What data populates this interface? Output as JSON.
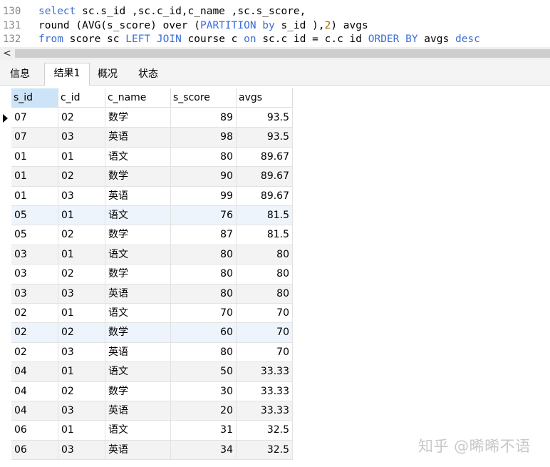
{
  "editor": {
    "lines": [
      {
        "num": "130",
        "parts": [
          {
            "t": "select",
            "c": "kw"
          },
          {
            "t": " sc.s_id ,sc.c_id,c_name ,sc.s_score,",
            "c": ""
          }
        ]
      },
      {
        "num": "131",
        "parts": [
          {
            "t": "round (AVG(s_score) over (",
            "c": ""
          },
          {
            "t": "PARTITION by",
            "c": "kw"
          },
          {
            "t": " s_id ),",
            "c": ""
          },
          {
            "t": "2",
            "c": "num"
          },
          {
            "t": ") avgs",
            "c": ""
          }
        ]
      },
      {
        "num": "132",
        "parts": [
          {
            "t": "from",
            "c": "kw"
          },
          {
            "t": " score sc ",
            "c": ""
          },
          {
            "t": "LEFT JOIN",
            "c": "kw"
          },
          {
            "t": " course c ",
            "c": ""
          },
          {
            "t": "on",
            "c": "kw"
          },
          {
            "t": " sc.c id = c.c id ",
            "c": ""
          },
          {
            "t": "ORDER BY",
            "c": "kw"
          },
          {
            "t": " avgs ",
            "c": ""
          },
          {
            "t": "desc",
            "c": "kw"
          }
        ]
      }
    ]
  },
  "scrollbar": {
    "left_arrow": "<"
  },
  "tabs": [
    {
      "label": "信息",
      "active": false
    },
    {
      "label": "结果1",
      "active": true
    },
    {
      "label": "概况",
      "active": false
    },
    {
      "label": "状态",
      "active": false
    }
  ],
  "grid": {
    "columns": [
      "s_id",
      "c_id",
      "c_name",
      "s_score",
      "avgs"
    ],
    "rows": [
      [
        "07",
        "02",
        "数学",
        "89",
        "93.5"
      ],
      [
        "07",
        "03",
        "英语",
        "98",
        "93.5"
      ],
      [
        "01",
        "01",
        "语文",
        "80",
        "89.67"
      ],
      [
        "01",
        "02",
        "数学",
        "90",
        "89.67"
      ],
      [
        "01",
        "03",
        "英语",
        "99",
        "89.67"
      ],
      [
        "05",
        "01",
        "语文",
        "76",
        "81.5"
      ],
      [
        "05",
        "02",
        "数学",
        "87",
        "81.5"
      ],
      [
        "03",
        "01",
        "语文",
        "80",
        "80"
      ],
      [
        "03",
        "02",
        "数学",
        "80",
        "80"
      ],
      [
        "03",
        "03",
        "英语",
        "80",
        "80"
      ],
      [
        "02",
        "01",
        "语文",
        "70",
        "70"
      ],
      [
        "02",
        "02",
        "数学",
        "60",
        "70"
      ],
      [
        "02",
        "03",
        "英语",
        "80",
        "70"
      ],
      [
        "04",
        "01",
        "语文",
        "50",
        "33.33"
      ],
      [
        "04",
        "02",
        "数学",
        "30",
        "33.33"
      ],
      [
        "04",
        "03",
        "英语",
        "20",
        "33.33"
      ],
      [
        "06",
        "01",
        "语文",
        "31",
        "32.5"
      ],
      [
        "06",
        "03",
        "英语",
        "34",
        "32.5"
      ]
    ]
  },
  "watermark": "知乎 @晞晞不语"
}
